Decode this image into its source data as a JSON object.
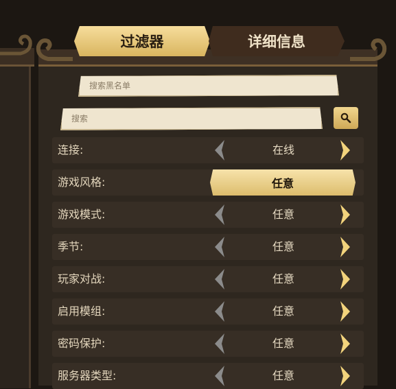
{
  "tabs": [
    {
      "label": "过滤器",
      "active": true
    },
    {
      "label": "详细信息",
      "active": false
    }
  ],
  "search": {
    "blacklist_placeholder": "搜索黑名单",
    "search_placeholder": "搜索",
    "search_button_icon": "magnifier-icon"
  },
  "colors": {
    "accent_gold": "#e2c06f",
    "panel_bg": "#2e271f",
    "row_bg": "#372e25",
    "label_text": "#e4d7bd"
  },
  "filters": [
    {
      "label": "连接:",
      "value": "在线",
      "style": "cycler"
    },
    {
      "label": "游戏风格:",
      "value": "任意",
      "style": "button"
    },
    {
      "label": "游戏模式:",
      "value": "任意",
      "style": "cycler"
    },
    {
      "label": "季节:",
      "value": "任意",
      "style": "cycler"
    },
    {
      "label": "玩家对战:",
      "value": "任意",
      "style": "cycler"
    },
    {
      "label": "启用模组:",
      "value": "任意",
      "style": "cycler"
    },
    {
      "label": "密码保护:",
      "value": "任意",
      "style": "cycler"
    },
    {
      "label": "服务器类型:",
      "value": "任意",
      "style": "cycler"
    }
  ]
}
